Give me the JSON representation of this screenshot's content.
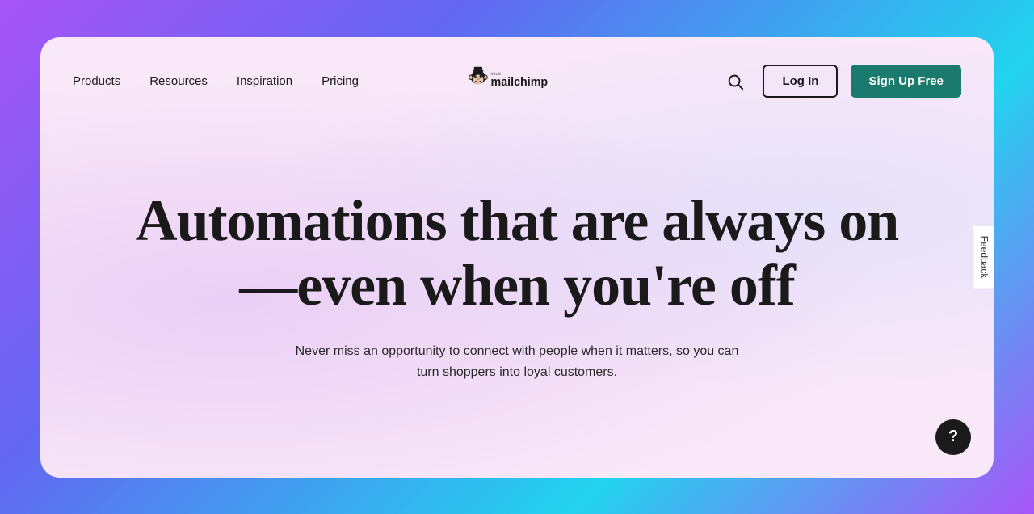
{
  "nav": {
    "items": [
      {
        "label": "Products",
        "id": "products"
      },
      {
        "label": "Resources",
        "id": "resources"
      },
      {
        "label": "Inspiration",
        "id": "inspiration"
      },
      {
        "label": "Pricing",
        "id": "pricing"
      }
    ],
    "login_label": "Log In",
    "signup_label": "Sign Up Free",
    "logo_alt": "Intuit Mailchimp"
  },
  "hero": {
    "title": "Automations that are always on—even when you're off",
    "subtitle": "Never miss an opportunity to connect with people when it matters, so you can turn shoppers into loyal customers."
  },
  "feedback": {
    "label": "Feedback"
  },
  "help": {
    "label": "?"
  },
  "colors": {
    "signup_bg": "#1a7a6e",
    "signup_text": "#ffffff",
    "card_bg": "#f9e8f8"
  }
}
